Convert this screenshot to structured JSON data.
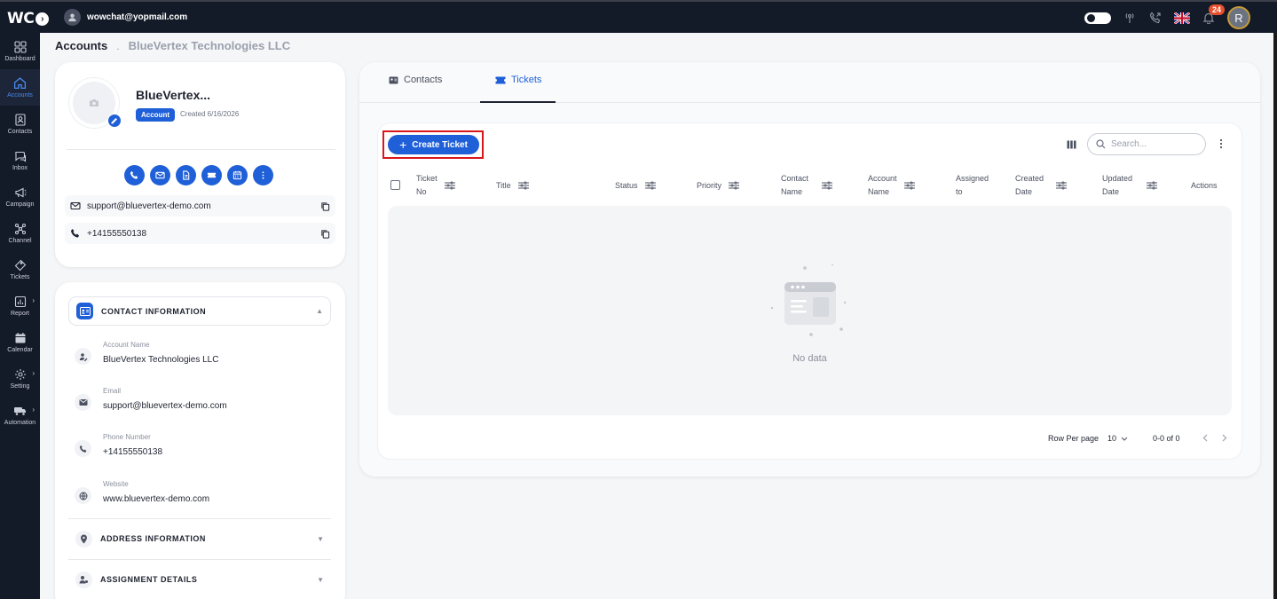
{
  "app": {
    "logo": "WC",
    "user_email": "wowchat@yopmail.com",
    "notification_count": "24",
    "profile_initial": "R"
  },
  "sidebar": {
    "items": [
      {
        "label": "Dashboard",
        "icon": "dashboard-icon",
        "active": false
      },
      {
        "label": "Accounts",
        "icon": "home-icon",
        "active": true
      },
      {
        "label": "Contacts",
        "icon": "contacts-icon",
        "active": false
      },
      {
        "label": "Inbox",
        "icon": "inbox-icon",
        "active": false
      },
      {
        "label": "Campaign",
        "icon": "campaign-icon",
        "active": false
      },
      {
        "label": "Channel",
        "icon": "channel-icon",
        "active": false
      },
      {
        "label": "Tickets",
        "icon": "ticket-icon",
        "active": false
      },
      {
        "label": "Report",
        "icon": "report-icon",
        "active": false
      },
      {
        "label": "Calendar",
        "icon": "calendar-icon",
        "active": false
      },
      {
        "label": "Setting",
        "icon": "gear-icon",
        "active": false
      },
      {
        "label": "Automation",
        "icon": "automation-icon",
        "active": false
      }
    ]
  },
  "breadcrumb": {
    "root": "Accounts",
    "separator": ".",
    "current": "BlueVertex Technologies LLC"
  },
  "profile": {
    "name": "BlueVertex...",
    "tag": "Account",
    "created": "Created 6/16/2026",
    "email": "support@bluevertex-demo.com",
    "phone": "+14155550138"
  },
  "contact_info": {
    "title": "CONTACT INFORMATION",
    "fields": [
      {
        "label": "Account Name",
        "value": "BlueVertex Technologies LLC"
      },
      {
        "label": "Email",
        "value": "support@bluevertex-demo.com"
      },
      {
        "label": "Phone Number",
        "value": "+14155550138"
      },
      {
        "label": "Website",
        "value": "www.bluevertex-demo.com"
      }
    ],
    "address_title": "ADDRESS INFORMATION",
    "assignment_title": "ASSIGNMENT DETAILS"
  },
  "tabs": {
    "contacts": "Contacts",
    "tickets": "Tickets"
  },
  "tickets": {
    "create_label": "Create Ticket",
    "search_placeholder": "Search...",
    "columns": {
      "ticket_no_1": "Ticket",
      "ticket_no_2": "No",
      "title": "Title",
      "status": "Status",
      "priority": "Priority",
      "contact_1": "Contact",
      "contact_2": "Name",
      "account_1": "Account",
      "account_2": "Name",
      "assigned_1": "Assigned",
      "assigned_2": "to",
      "created_1": "Created",
      "created_2": "Date",
      "updated_1": "Updated",
      "updated_2": "Date",
      "actions": "Actions"
    },
    "empty_text": "No data",
    "rows_per_page_label": "Row Per page",
    "rows_per_page_value": "10",
    "range": "0-0 of 0"
  },
  "colors": {
    "primary": "#1f5fd8",
    "sidebar_bg": "#131a28",
    "highlight": "#d9161c",
    "badge": "#e8502c"
  }
}
